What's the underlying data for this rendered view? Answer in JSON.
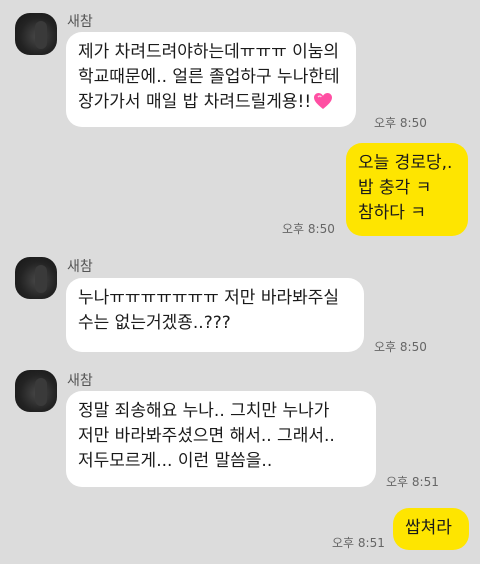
{
  "messages": [
    {
      "direction": "in",
      "sender": "새참",
      "lines": [
        "제가 차려드려야하는데ㅠㅠㅠ 이눔의",
        "학교때문에.. 얼른 졸업하구 누나한테",
        "장가가서 매일 밥 차려드릴게용!!"
      ],
      "emoji": "heart-icon",
      "time": "오후 8:50"
    },
    {
      "direction": "out",
      "lines": [
        "오늘 경로당,.",
        "밥 충각 ㅋ",
        "참하다 ㅋ"
      ],
      "time": "오후 8:50"
    },
    {
      "direction": "in",
      "sender": "새참",
      "lines": [
        "누나ㅠㅠㅠㅠㅠㅠㅠ 저만 바라봐주실",
        "수는 없는거겠죵..???"
      ],
      "time": "오후 8:50"
    },
    {
      "direction": "in",
      "sender": "새참",
      "lines": [
        "정말 죄송해요 누나.. 그치만 누나가",
        "저만 바라봐주셨으면 해서.. 그래서..",
        "저두모르게... 이런 말씀을.."
      ],
      "time": "오후 8:51"
    },
    {
      "direction": "out",
      "lines": [
        "쌉쳐라"
      ],
      "time": "오후 8:51"
    }
  ],
  "colors": {
    "background": "#dcdcdc",
    "incoming_bubble": "#ffffff",
    "outgoing_bubble": "#fee500"
  }
}
